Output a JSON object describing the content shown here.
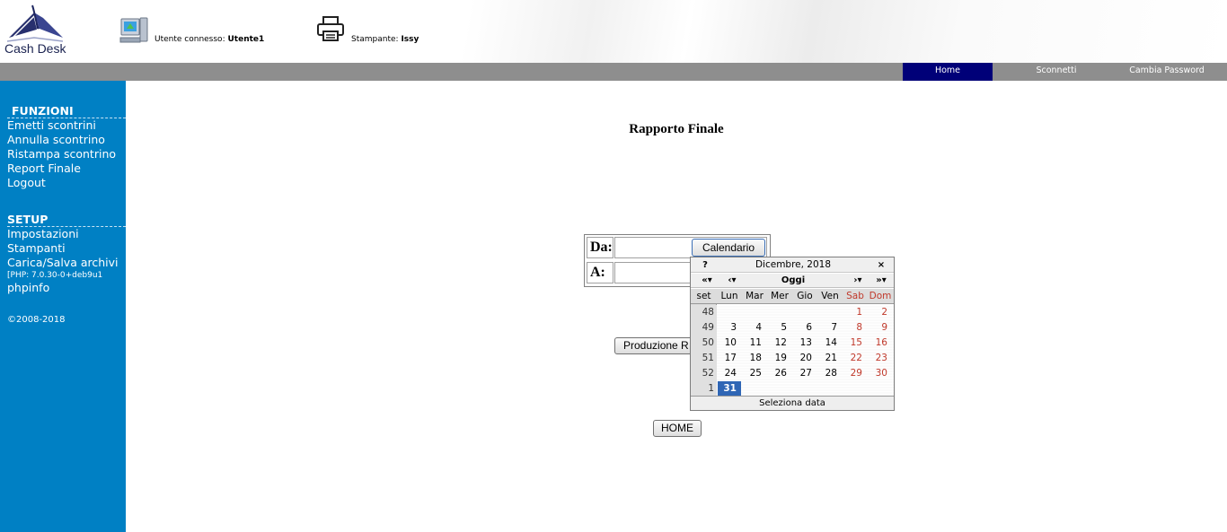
{
  "header": {
    "app_name": "Cash Desk",
    "user_label": "Utente connesso:",
    "user_name": "Utente1",
    "printer_label": "Stampante:",
    "printer_name": "Issy"
  },
  "nav": {
    "home": "Home",
    "logout": "Sconnetti",
    "change_password": "Cambia Password"
  },
  "sidebar": {
    "functions_heading": "FUNZIONI",
    "functions": [
      "Emetti scontrini",
      "Annulla scontrino",
      "Ristampa scontrino",
      "Report Finale",
      "Logout"
    ],
    "setup_heading": "SETUP",
    "setup": [
      "Impostazioni",
      "Stampanti",
      "Carica/Salva archivi"
    ],
    "php_version": "[PHP: 7.0.30-0+deb9u1",
    "phpinfo": "phpinfo",
    "copyright": "©2008-2018"
  },
  "main": {
    "title": "Rapporto Finale",
    "from_label": "Da:",
    "to_label": "A:",
    "from_value": "",
    "to_value": "",
    "calendar_button": "Calendario",
    "production_button": "Produzione R",
    "home_button": "HOME"
  },
  "calendar": {
    "help": "?",
    "month_year": "Dicembre, 2018",
    "close": "×",
    "prev_year": "«▾",
    "prev_month": "‹▾",
    "today": "Oggi",
    "next_month": "›▾",
    "next_year": "»▾",
    "week_header": "set",
    "day_names": [
      "Lun",
      "Mar",
      "Mer",
      "Gio",
      "Ven",
      "Sab",
      "Dom"
    ],
    "weeks": [
      {
        "week": "48",
        "days": [
          "",
          "",
          "",
          "",
          "",
          "1",
          "2"
        ]
      },
      {
        "week": "49",
        "days": [
          "3",
          "4",
          "5",
          "6",
          "7",
          "8",
          "9"
        ]
      },
      {
        "week": "50",
        "days": [
          "10",
          "11",
          "12",
          "13",
          "14",
          "15",
          "16"
        ]
      },
      {
        "week": "51",
        "days": [
          "17",
          "18",
          "19",
          "20",
          "21",
          "22",
          "23"
        ]
      },
      {
        "week": "52",
        "days": [
          "24",
          "25",
          "26",
          "27",
          "28",
          "29",
          "30"
        ]
      },
      {
        "week": "1",
        "days": [
          "31",
          "",
          "",
          "",
          "",
          "",
          ""
        ]
      }
    ],
    "selected_day": "31",
    "footer": "Seleziona data",
    "weekend_color": "#c0392b",
    "selected_color": "#2f66b5"
  },
  "colors": {
    "sidebar": "#0080c4",
    "nav_bar": "#8e8e8e",
    "nav_active": "#000078"
  }
}
